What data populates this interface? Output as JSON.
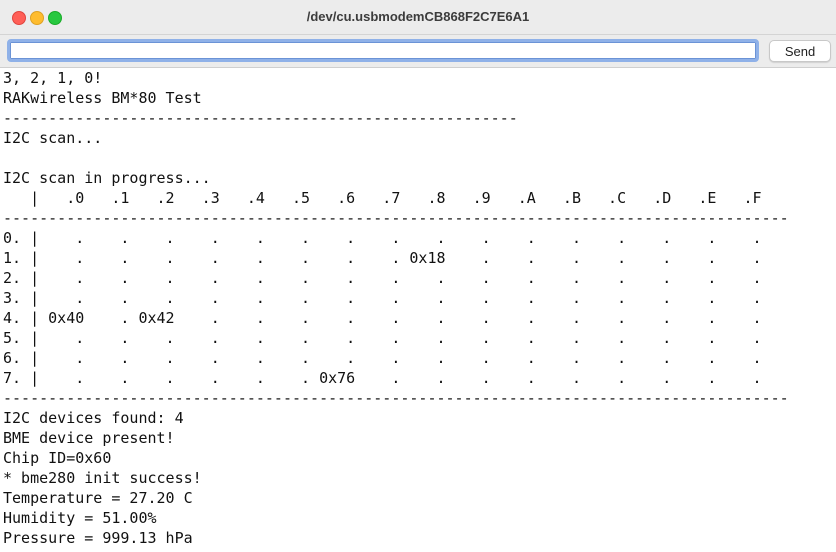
{
  "window": {
    "title": "/dev/cu.usbmodemCB868F2C7E6A1"
  },
  "input": {
    "value": "",
    "send_label": "Send"
  },
  "output": {
    "lines": [
      "3, 2, 1, 0!",
      "RAKwireless BM*80 Test",
      "---------------------------------------------------------",
      "I2C scan...",
      "",
      "I2C scan in progress...",
      "   |   .0   .1   .2   .3   .4   .5   .6   .7   .8   .9   .A   .B   .C   .D   .E   .F",
      "---------------------------------------------------------------------------------------",
      "0. |    .    .    .    .    .    .    .    .    .    .    .    .    .    .    .    .",
      "1. |    .    .    .    .    .    .    .    . 0x18    .    .    .    .    .    .    .",
      "2. |    .    .    .    .    .    .    .    .    .    .    .    .    .    .    .    .",
      "3. |    .    .    .    .    .    .    .    .    .    .    .    .    .    .    .    .",
      "4. | 0x40    . 0x42    .    .    .    .    .    .    .    .    .    .    .    .    .",
      "5. |    .    .    .    .    .    .    .    .    .    .    .    .    .    .    .    .",
      "6. |    .    .    .    .    .    .    .    .    .    .    .    .    .    .    .    .",
      "7. |    .    .    .    .    .    . 0x76    .    .    .    .    .    .    .    .    .",
      "---------------------------------------------------------------------------------------",
      "I2C devices found: 4",
      "BME device present!",
      "Chip ID=0x60",
      "* bme280 init success!",
      "Temperature = 27.20 C",
      "Humidity = 51.00%",
      "Pressure = 999.13 hPa"
    ]
  }
}
